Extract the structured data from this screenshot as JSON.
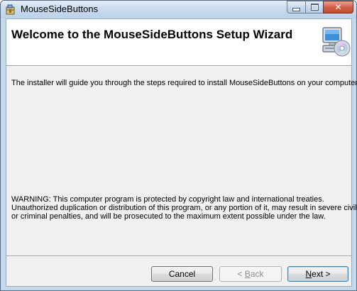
{
  "window": {
    "title": "MouseSideButtons",
    "icon": "installer-package-icon",
    "caption_buttons": [
      "minimize",
      "maximize",
      "close"
    ]
  },
  "header": {
    "title": "Welcome to the MouseSideButtons Setup Wizard",
    "art": "computer-with-cd-icon"
  },
  "body": {
    "intro": "The installer will guide you through the steps required to install MouseSideButtons on your computer.",
    "warning_lines": [
      "WARNING: This computer program is protected by copyright law and international treaties.",
      "Unauthorized duplication or distribution of this program, or any portion of it, may result in severe civil",
      "or criminal penalties, and will be prosecuted to the maximum extent possible under the law."
    ]
  },
  "buttons": {
    "cancel": "Cancel",
    "back_prefix": "< ",
    "back_accel": "B",
    "back_rest": "ack",
    "next_accel": "N",
    "next_rest": "ext >"
  },
  "colors": {
    "title_bar": "#c4d8ec",
    "close_button": "#c44b2f",
    "dialog_face": "#f0f0f0",
    "default_button_border": "#3c7fb1"
  }
}
